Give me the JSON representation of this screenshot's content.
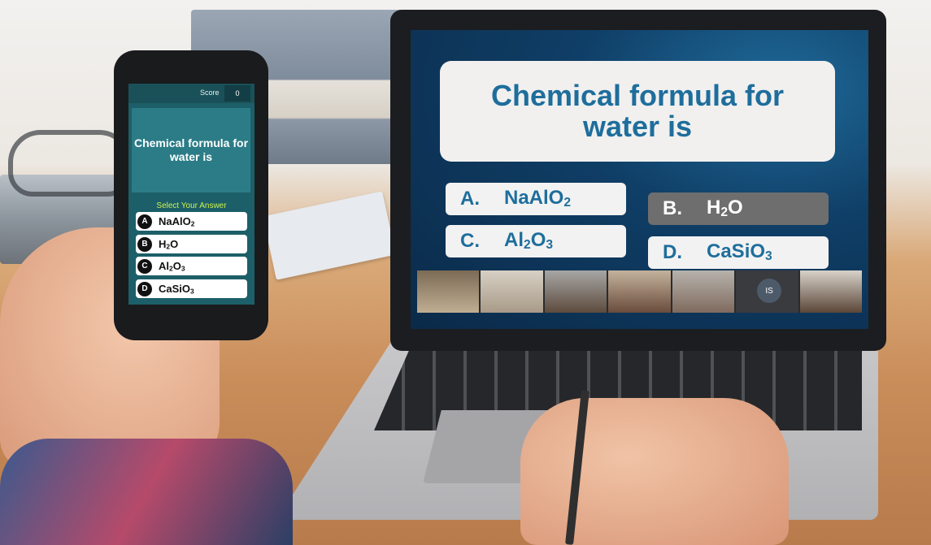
{
  "laptop": {
    "question": "Chemical formula for water is",
    "options": [
      {
        "letter": "A.",
        "answer_main": "NaAlO",
        "answer_sub": "2",
        "answer_tail": "",
        "selected": false
      },
      {
        "letter": "B.",
        "answer_main": "H",
        "answer_sub": "2",
        "answer_tail": "O",
        "selected": true
      },
      {
        "letter": "C.",
        "answer_main": "Al",
        "answer_sub": "2",
        "answer_tail": "O",
        "answer_sub2": "3",
        "selected": false
      },
      {
        "letter": "D.",
        "answer_main": "CaSiO",
        "answer_sub": "3",
        "answer_tail": "",
        "selected": false
      }
    ],
    "video_avatar_initials": "IS"
  },
  "phone": {
    "score_label": "Score",
    "score_value": "0",
    "question": "Chemical formula for water is",
    "prompt": "Select Your Answer",
    "options": [
      {
        "letter": "A",
        "main": "NaAlO",
        "sub": "2",
        "tail": ""
      },
      {
        "letter": "B",
        "main": "H",
        "sub": "2",
        "tail": "O"
      },
      {
        "letter": "C",
        "main": "Al",
        "sub": "2",
        "tail": "O",
        "sub2": "3"
      },
      {
        "letter": "D",
        "main": "CaSiO",
        "sub": "3",
        "tail": ""
      }
    ]
  },
  "colors": {
    "quiz_blue": "#1e6e9c",
    "selected_gray": "#6e6e6e",
    "phone_teal": "#1d5f68",
    "prompt_green": "#ccf24d"
  }
}
